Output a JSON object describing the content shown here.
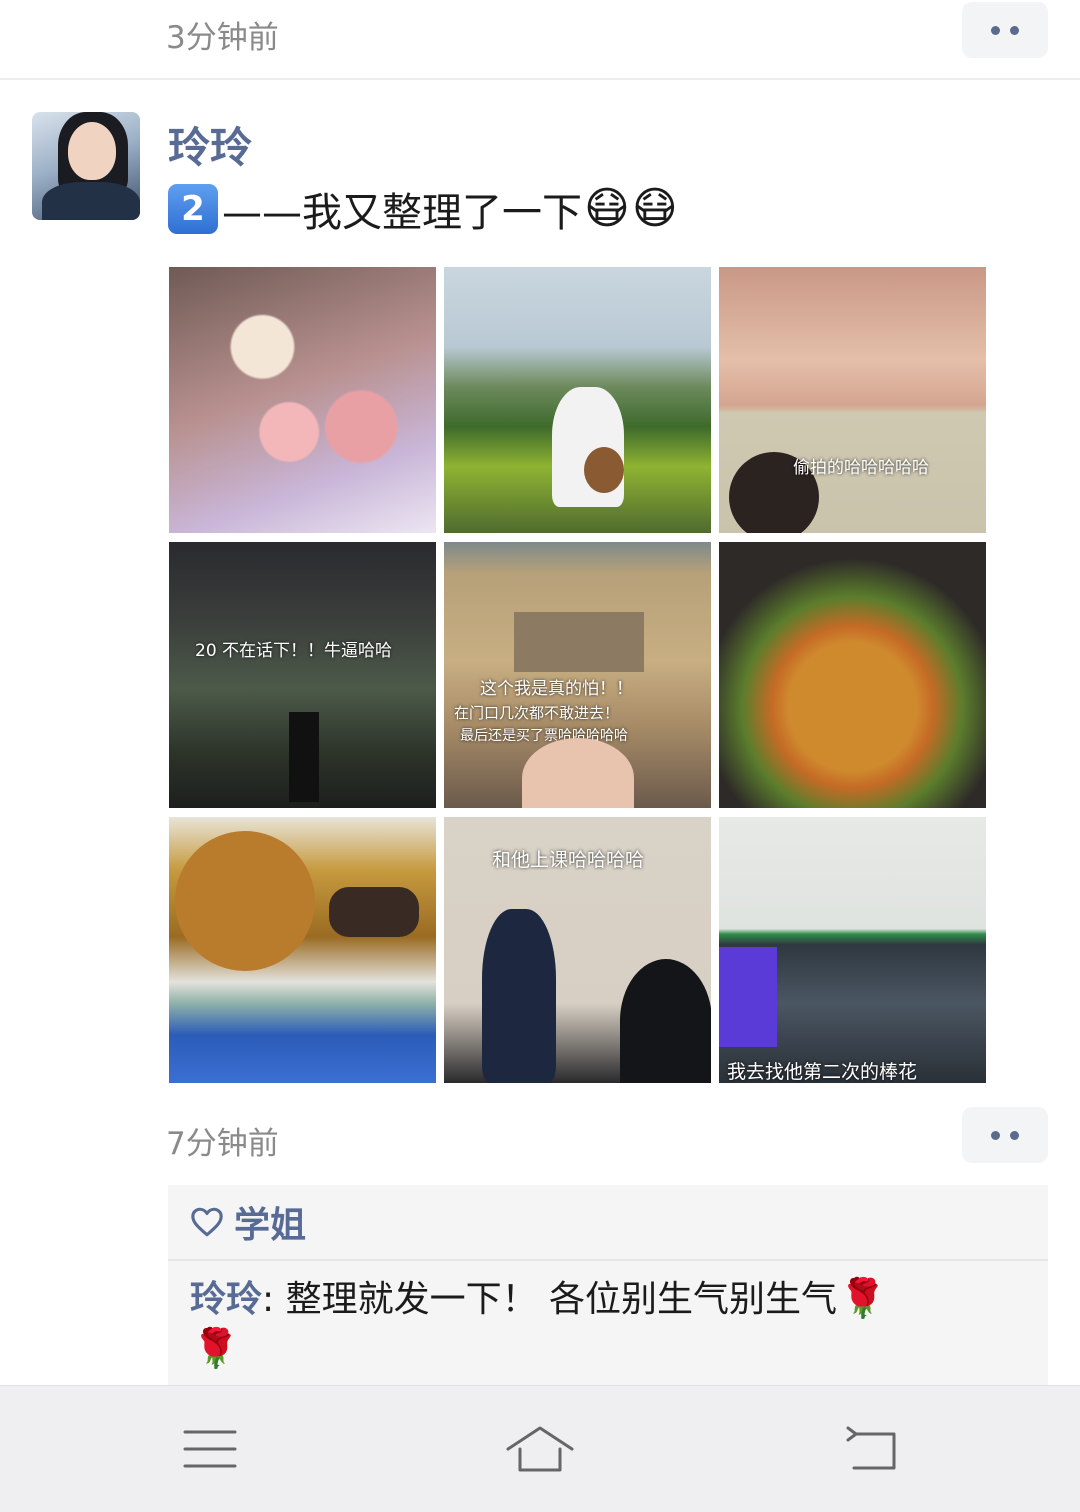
{
  "previous_post": {
    "time": "3分钟前"
  },
  "post": {
    "author": "玲玲",
    "number_badge": "2",
    "text": "——我又整理了一下",
    "emoji": "😷",
    "time": "7分钟前",
    "photos": [
      {
        "subject": "flower-bouquet",
        "caption": ""
      },
      {
        "subject": "girl-with-dog-in-park",
        "caption": ""
      },
      {
        "subject": "selfie-couple",
        "caption": "偷拍的哈哈哈哈哈"
      },
      {
        "subject": "night-tree-silhouette",
        "caption": "20   不在话下！！牛逼哈哈"
      },
      {
        "subject": "building-gate",
        "caption": "这个我是真的怕！！"
      },
      {
        "subject": "stir-fry-dish",
        "caption": ""
      },
      {
        "subject": "burger-and-skewers",
        "caption": ""
      },
      {
        "subject": "teacher-in-classroom",
        "caption": "和他上课哈哈哈哈"
      },
      {
        "subject": "subway-station",
        "caption": "我去找他第二次的棒花"
      }
    ],
    "photo_captions_extra": [
      "在门口几次都不敢进去！",
      "最后还是买了票哈哈哈哈哈"
    ]
  },
  "likes": {
    "names": "学姐"
  },
  "comments": [
    {
      "author": "玲玲",
      "separator": ": ",
      "text": "整理就发一下！ 各位别生气别生气",
      "emoji": "🌹"
    }
  ],
  "nav": {
    "menu": "menu-icon",
    "home": "home-icon",
    "back": "back-icon"
  },
  "colors": {
    "link_blue": "#576b95",
    "muted": "#8a8a8a",
    "panel": "#f5f5f5"
  }
}
